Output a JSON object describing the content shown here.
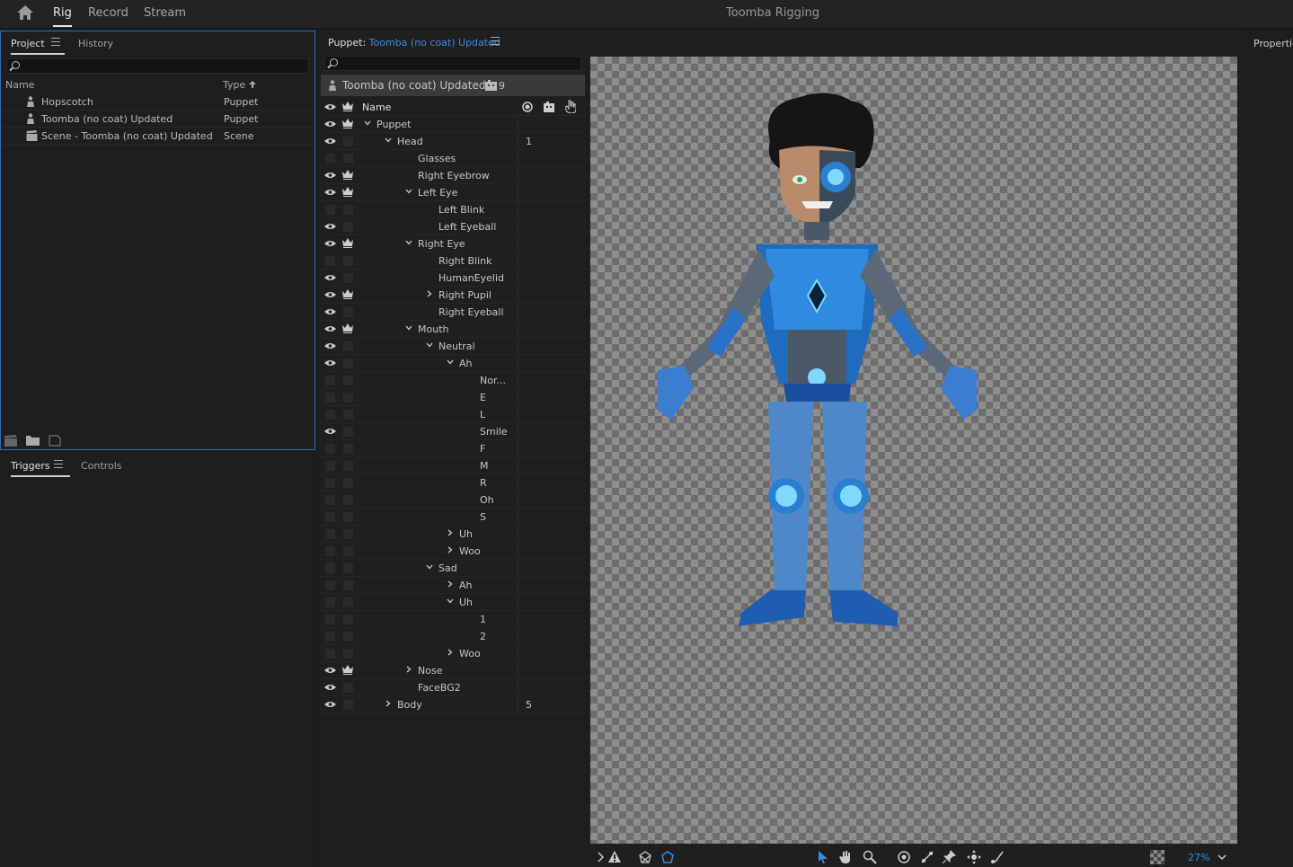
{
  "topbar": {
    "tabs": [
      {
        "label": "Rig",
        "active": true
      },
      {
        "label": "Record",
        "active": false
      },
      {
        "label": "Stream",
        "active": false
      }
    ],
    "document_title": "Toomba Rigging"
  },
  "project_panel": {
    "tabs": [
      {
        "label": "Project",
        "active": true
      },
      {
        "label": "History",
        "active": false
      }
    ],
    "search": {
      "value": "",
      "placeholder": ""
    },
    "columns": {
      "name": "Name",
      "type": "Type"
    },
    "rows": [
      {
        "name": "Hopscotch",
        "type": "Puppet",
        "icon": "puppet-icon"
      },
      {
        "name": "Toomba (no coat) Updated",
        "type": "Puppet",
        "icon": "puppet-icon"
      },
      {
        "name": "Scene - Toomba (no coat) Updated",
        "type": "Scene",
        "icon": "scene-icon"
      }
    ]
  },
  "triggers_panel": {
    "tabs": [
      {
        "label": "Triggers",
        "active": true
      },
      {
        "label": "Controls",
        "active": false
      }
    ]
  },
  "puppet_panel": {
    "header_prefix": "Puppet:",
    "header_name": "Toomba (no coat) Updated",
    "search": {
      "value": "",
      "placeholder": ""
    },
    "puppet_bar": {
      "label": "Toomba (no coat) Updated",
      "count": "9"
    },
    "name_header": "Name",
    "rows": [
      {
        "label": "Puppet",
        "depth": 0,
        "expander": "open",
        "eye": true,
        "crown": true,
        "count": ""
      },
      {
        "label": "Head",
        "depth": 1,
        "expander": "open",
        "eye": true,
        "crown": false,
        "count": "1"
      },
      {
        "label": "Glasses",
        "depth": 2,
        "expander": "none",
        "eye": false,
        "crown": false,
        "count": ""
      },
      {
        "label": "Right Eyebrow",
        "depth": 2,
        "expander": "none",
        "eye": true,
        "crown": true,
        "count": ""
      },
      {
        "label": "Left Eye",
        "depth": 2,
        "expander": "open",
        "eye": true,
        "crown": true,
        "count": ""
      },
      {
        "label": "Left Blink",
        "depth": 3,
        "expander": "none",
        "eye": false,
        "crown": false,
        "count": ""
      },
      {
        "label": "Left Eyeball",
        "depth": 3,
        "expander": "none",
        "eye": true,
        "crown": false,
        "count": ""
      },
      {
        "label": "Right Eye",
        "depth": 2,
        "expander": "open",
        "eye": true,
        "crown": true,
        "count": ""
      },
      {
        "label": "Right Blink",
        "depth": 3,
        "expander": "none",
        "eye": false,
        "crown": false,
        "count": ""
      },
      {
        "label": "HumanEyelid",
        "depth": 3,
        "expander": "none",
        "eye": true,
        "crown": false,
        "count": ""
      },
      {
        "label": "Right Pupil",
        "depth": 3,
        "expander": "closed",
        "eye": true,
        "crown": true,
        "count": ""
      },
      {
        "label": "Right Eyeball",
        "depth": 3,
        "expander": "none",
        "eye": true,
        "crown": false,
        "count": ""
      },
      {
        "label": "Mouth",
        "depth": 2,
        "expander": "open",
        "eye": true,
        "crown": true,
        "count": ""
      },
      {
        "label": "Neutral",
        "depth": 3,
        "expander": "open",
        "eye": true,
        "crown": false,
        "count": ""
      },
      {
        "label": "Ah",
        "depth": 4,
        "expander": "open",
        "eye": true,
        "crown": false,
        "count": ""
      },
      {
        "label": "Nor...",
        "depth": 5,
        "expander": "none",
        "eye": false,
        "crown": false,
        "count": ""
      },
      {
        "label": "E",
        "depth": 5,
        "expander": "none",
        "eye": false,
        "crown": false,
        "count": ""
      },
      {
        "label": "L",
        "depth": 5,
        "expander": "none",
        "eye": false,
        "crown": false,
        "count": ""
      },
      {
        "label": "Smile",
        "depth": 5,
        "expander": "none",
        "eye": true,
        "crown": false,
        "count": ""
      },
      {
        "label": "F",
        "depth": 5,
        "expander": "none",
        "eye": false,
        "crown": false,
        "count": ""
      },
      {
        "label": "M",
        "depth": 5,
        "expander": "none",
        "eye": false,
        "crown": false,
        "count": ""
      },
      {
        "label": "R",
        "depth": 5,
        "expander": "none",
        "eye": false,
        "crown": false,
        "count": ""
      },
      {
        "label": "Oh",
        "depth": 5,
        "expander": "none",
        "eye": false,
        "crown": false,
        "count": ""
      },
      {
        "label": "S",
        "depth": 5,
        "expander": "none",
        "eye": false,
        "crown": false,
        "count": ""
      },
      {
        "label": "Uh",
        "depth": 4,
        "expander": "closed",
        "eye": false,
        "crown": false,
        "count": ""
      },
      {
        "label": "Woo",
        "depth": 4,
        "expander": "closed",
        "eye": false,
        "crown": false,
        "count": ""
      },
      {
        "label": "Sad",
        "depth": 3,
        "expander": "open",
        "eye": false,
        "crown": false,
        "count": ""
      },
      {
        "label": "Ah",
        "depth": 4,
        "expander": "closed",
        "eye": false,
        "crown": false,
        "count": ""
      },
      {
        "label": "Uh",
        "depth": 4,
        "expander": "open",
        "eye": false,
        "crown": false,
        "count": ""
      },
      {
        "label": "1",
        "depth": 5,
        "expander": "none",
        "eye": false,
        "crown": false,
        "count": ""
      },
      {
        "label": "2",
        "depth": 5,
        "expander": "none",
        "eye": false,
        "crown": false,
        "count": ""
      },
      {
        "label": "Woo",
        "depth": 4,
        "expander": "closed",
        "eye": false,
        "crown": false,
        "count": ""
      },
      {
        "label": "Nose",
        "depth": 2,
        "expander": "closed",
        "eye": true,
        "crown": true,
        "count": ""
      },
      {
        "label": "FaceBG2",
        "depth": 2,
        "expander": "none",
        "eye": true,
        "crown": false,
        "count": ""
      },
      {
        "label": "Body",
        "depth": 1,
        "expander": "closed",
        "eye": true,
        "crown": false,
        "count": "5"
      }
    ]
  },
  "viewer": {
    "zoom": "27%"
  },
  "properties_panel": {
    "title": "Properties"
  },
  "colors": {
    "accent_blue": "#3b8edc",
    "panel_bg": "#1e1e1e",
    "focus_border": "#2d6fb8"
  }
}
